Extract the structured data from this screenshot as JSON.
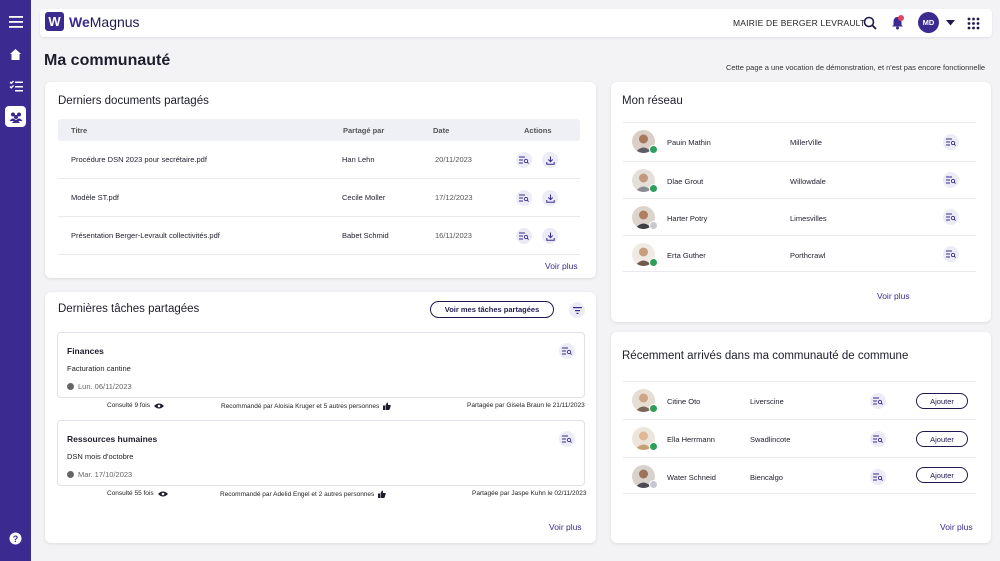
{
  "app": {
    "logo_letter": "W",
    "logo_bold": "We",
    "logo_rest": "Magnus",
    "org": "MAIRIE DE BERGER LEVRAULT",
    "user_initials": "MD",
    "accent": "#3b2a8f"
  },
  "rail": {
    "items": [
      "menu-icon",
      "home-icon",
      "checklist-icon",
      "community-icon",
      "help-icon"
    ]
  },
  "page": {
    "title": "Ma communauté",
    "demo_note": "Cette page a une vocation de démonstration, et n'est pas encore fonctionnelle"
  },
  "documents": {
    "title": "Derniers documents partagés",
    "headers": {
      "title": "Titre",
      "shared_by": "Partagé par",
      "date": "Date",
      "actions": "Actions"
    },
    "rows": [
      {
        "title": "Procédure DSN 2023 pour secrétaire.pdf",
        "shared_by": "Han Lehn",
        "date": "20/11/2023"
      },
      {
        "title": "Modèle ST.pdf",
        "shared_by": "Cecile Moller",
        "date": "17/12/2023"
      },
      {
        "title": "Présentation Berger-Levrault collectivités.pdf",
        "shared_by": "Babet Schmid",
        "date": "16/11/2023"
      }
    ],
    "more": "Voir plus"
  },
  "tasks": {
    "title": "Dernières tâches partagées",
    "button": "Voir mes tâches partagées",
    "items": [
      {
        "title": "Finances",
        "subtitle": "Facturation cantine",
        "date": "Lun. 06/11/2023",
        "views": "Consulté 9 fois",
        "recommended": "Recommandé par Aloisia Kruger et 5 autres personnes",
        "shared": "Partagée par Gisela Braun le 21/11/2023"
      },
      {
        "title": "Ressources humaines",
        "subtitle": "DSN mois d'octobre",
        "date": "Mar. 17/10/2023",
        "views": "Consulté 55 fois",
        "recommended": "Recommandé par Adelid Engel et 2 autres personnes",
        "shared": "Partagée par Jaspe Kuhn le 02/11/2023"
      }
    ],
    "more": "Voir plus"
  },
  "network": {
    "title": "Mon réseau",
    "people": [
      {
        "name": "Pauin Mathin",
        "city": "MillerVille",
        "status": "online"
      },
      {
        "name": "Dlae Grout",
        "city": "Willowdale",
        "status": "online"
      },
      {
        "name": "Harter Potry",
        "city": "Limesvilles",
        "status": "offline"
      },
      {
        "name": "Erta Guther",
        "city": "Porthcrawl",
        "status": "online"
      }
    ],
    "more": "Voir plus"
  },
  "newcomers": {
    "title": "Récemment arrivés dans ma communauté de commune",
    "add_label": "Ajouter",
    "people": [
      {
        "name": "Citine Oto",
        "city": "Liverscine",
        "status": "online"
      },
      {
        "name": "Ella Herrmann",
        "city": "Swadlincote",
        "status": "online"
      },
      {
        "name": "Water Schneid",
        "city": "Biencalgo",
        "status": "offline"
      }
    ],
    "more": "Voir plus"
  },
  "colors": {
    "online": "#2e9e5b",
    "offline": "#c8c8d0",
    "accent": "#3b2a8f",
    "badge": "#e0455a"
  }
}
